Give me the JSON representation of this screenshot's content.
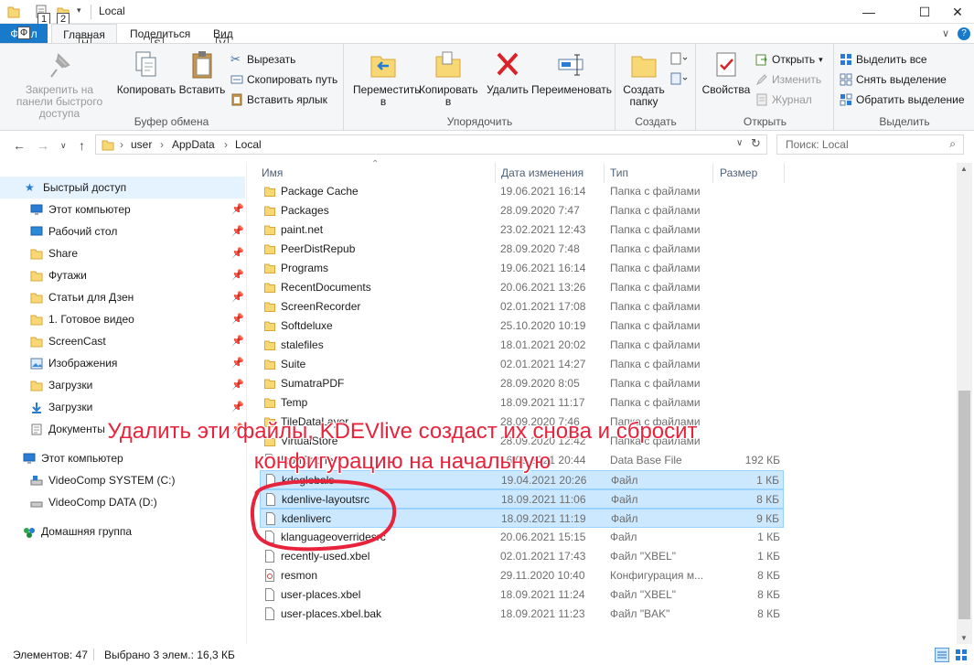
{
  "titlebar": {
    "title": "Local",
    "keytip_1": "1",
    "keytip_2": "2",
    "min": "—",
    "max": "☐",
    "close": "✕"
  },
  "tabs": {
    "file": "Файл",
    "home": "Главная",
    "share": "Поделиться",
    "view": "Вид",
    "keytip_f": "Ф",
    "keytip_h": "Н",
    "keytip_s": "S",
    "keytip_v": "V",
    "help": "?"
  },
  "ribbon": {
    "clipboard": {
      "pin": "Закрепить на панели быстрого доступа",
      "copy": "Копировать",
      "paste": "Вставить",
      "cut": "Вырезать",
      "copy_path": "Скопировать путь",
      "paste_shortcut": "Вставить ярлык",
      "label": "Буфер обмена"
    },
    "organize": {
      "move": "Переместить в",
      "copy_to": "Копировать в",
      "delete": "Удалить",
      "rename": "Переименовать",
      "label": "Упорядочить"
    },
    "new": {
      "new_folder": "Создать папку",
      "label": "Создать"
    },
    "open": {
      "properties": "Свойства",
      "open": "Открыть",
      "edit": "Изменить",
      "history": "Журнал",
      "label": "Открыть"
    },
    "select": {
      "select_all": "Выделить все",
      "select_none": "Снять выделение",
      "invert": "Обратить выделение",
      "label": "Выделить"
    }
  },
  "address": {
    "crumbs": [
      "user",
      "AppData",
      "Local"
    ],
    "search_placeholder": "Поиск: Local"
  },
  "nav": {
    "quick_access": "Быстрый доступ",
    "items": [
      {
        "label": "Этот компьютер",
        "icon": "monitor-icon",
        "pinned": true
      },
      {
        "label": "Рабочий стол",
        "icon": "desktop-icon",
        "pinned": true
      },
      {
        "label": "Share",
        "icon": "folder-icon",
        "pinned": true
      },
      {
        "label": "Футажи",
        "icon": "folder-icon",
        "pinned": true
      },
      {
        "label": "Статьи для Дзен",
        "icon": "folder-icon",
        "pinned": true
      },
      {
        "label": "1. Готовое видео",
        "icon": "folder-icon",
        "pinned": true
      },
      {
        "label": "ScreenCast",
        "icon": "folder-icon",
        "pinned": true
      },
      {
        "label": "Изображения",
        "icon": "pictures-icon",
        "pinned": true
      },
      {
        "label": "Загрузки",
        "icon": "folder-icon",
        "pinned": true
      },
      {
        "label": "Загрузки",
        "icon": "download-icon",
        "pinned": true
      },
      {
        "label": "Документы",
        "icon": "documents-icon",
        "pinned": true
      }
    ],
    "this_pc": "Этот компьютер",
    "drives": [
      {
        "label": "VideoComp SYSTEM (C:)"
      },
      {
        "label": "VideoComp DATA (D:)"
      }
    ],
    "homegroup": "Домашняя группа"
  },
  "columns": {
    "name": "Имя",
    "date": "Дата изменения",
    "type": "Тип",
    "size": "Размер"
  },
  "files": [
    {
      "name": "Package Cache",
      "date": "19.06.2021 16:14",
      "type": "Папка с файлами",
      "size": "",
      "kind": "folder",
      "selected": false
    },
    {
      "name": "Packages",
      "date": "28.09.2020 7:47",
      "type": "Папка с файлами",
      "size": "",
      "kind": "folder",
      "selected": false
    },
    {
      "name": "paint.net",
      "date": "23.02.2021 12:43",
      "type": "Папка с файлами",
      "size": "",
      "kind": "folder",
      "selected": false
    },
    {
      "name": "PeerDistRepub",
      "date": "28.09.2020 7:48",
      "type": "Папка с файлами",
      "size": "",
      "kind": "folder",
      "selected": false
    },
    {
      "name": "Programs",
      "date": "19.06.2021 16:14",
      "type": "Папка с файлами",
      "size": "",
      "kind": "folder",
      "selected": false
    },
    {
      "name": "RecentDocuments",
      "date": "20.06.2021 13:26",
      "type": "Папка с файлами",
      "size": "",
      "kind": "folder",
      "selected": false
    },
    {
      "name": "ScreenRecorder",
      "date": "02.01.2021 17:08",
      "type": "Папка с файлами",
      "size": "",
      "kind": "folder",
      "selected": false
    },
    {
      "name": "Softdeluxe",
      "date": "25.10.2020 10:19",
      "type": "Папка с файлами",
      "size": "",
      "kind": "folder",
      "selected": false
    },
    {
      "name": "stalefiles",
      "date": "18.01.2021 20:02",
      "type": "Папка с файлами",
      "size": "",
      "kind": "folder",
      "selected": false
    },
    {
      "name": "Suite",
      "date": "02.01.2021 14:27",
      "type": "Папка с файлами",
      "size": "",
      "kind": "folder",
      "selected": false
    },
    {
      "name": "SumatraPDF",
      "date": "28.09.2020 8:05",
      "type": "Папка с файлами",
      "size": "",
      "kind": "folder",
      "selected": false
    },
    {
      "name": "Temp",
      "date": "18.09.2021 11:17",
      "type": "Папка с файлами",
      "size": "",
      "kind": "folder",
      "selected": false
    },
    {
      "name": "TileDataLayer",
      "date": "28.09.2020 7:46",
      "type": "Папка с файлами",
      "size": "",
      "kind": "folder",
      "selected": false
    },
    {
      "name": "VirtualStore",
      "date": "28.09.2020 12:42",
      "type": "Папка с файлами",
      "size": "",
      "kind": "folder",
      "selected": false
    },
    {
      "name": "IconCache",
      "date": "16.09.2021 20:44",
      "type": "Data Base File",
      "size": "192 КБ",
      "kind": "file",
      "selected": false
    },
    {
      "name": "kdeglobals",
      "date": "19.04.2021 20:26",
      "type": "Файл",
      "size": "1 КБ",
      "kind": "file",
      "selected": true
    },
    {
      "name": "kdenlive-layoutsrc",
      "date": "18.09.2021 11:06",
      "type": "Файл",
      "size": "8 КБ",
      "kind": "file",
      "selected": true
    },
    {
      "name": "kdenliverc",
      "date": "18.09.2021 11:19",
      "type": "Файл",
      "size": "9 КБ",
      "kind": "file",
      "selected": true
    },
    {
      "name": "klanguageoverridesrc",
      "date": "20.06.2021 15:15",
      "type": "Файл",
      "size": "1 КБ",
      "kind": "file",
      "selected": false
    },
    {
      "name": "recently-used.xbel",
      "date": "02.01.2021 17:43",
      "type": "Файл \"XBEL\"",
      "size": "1 КБ",
      "kind": "file",
      "selected": false
    },
    {
      "name": "resmon",
      "date": "29.11.2020 10:40",
      "type": "Конфигурация м...",
      "size": "8 КБ",
      "kind": "config",
      "selected": false
    },
    {
      "name": "user-places.xbel",
      "date": "18.09.2021 11:24",
      "type": "Файл \"XBEL\"",
      "size": "8 КБ",
      "kind": "file",
      "selected": false
    },
    {
      "name": "user-places.xbel.bak",
      "date": "18.09.2021 11:23",
      "type": "Файл \"BAK\"",
      "size": "8 КБ",
      "kind": "file",
      "selected": false
    }
  ],
  "status": {
    "count": "Элементов: 47",
    "selected": "Выбрано 3 элем.: 16,3 КБ"
  },
  "annotation": {
    "line1": "Удалить эти файлы, KDEVlive создаст их снова и сбросит",
    "line2": "конфигурацию на начальную"
  },
  "colors": {
    "accent": "#1979ca",
    "selection": "#cce8ff",
    "annotation": "#e8233c",
    "folder": "#f8d775"
  }
}
